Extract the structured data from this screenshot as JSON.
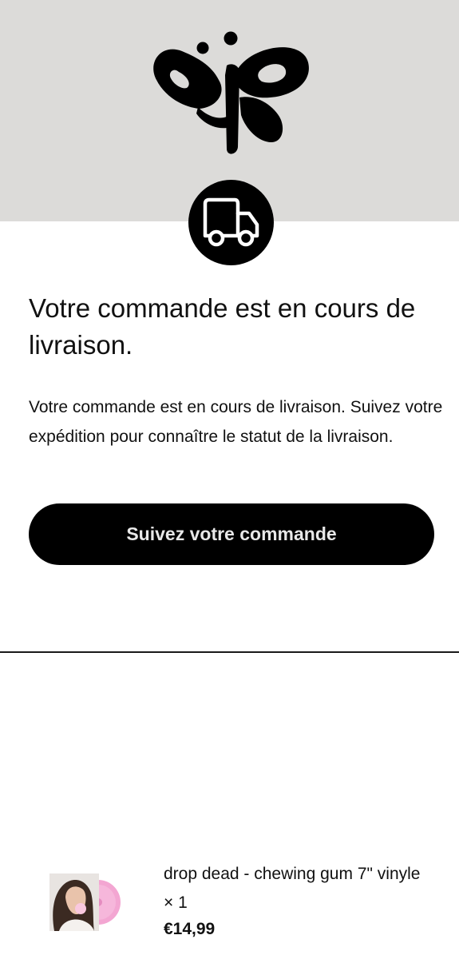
{
  "email": {
    "headline": "Votre commande est en cours de livraison.",
    "body": "Votre commande est en cours de livraison. Suivez votre expédition pour connaître le statut de la livraison.",
    "track_button_label": "Suivez votre commande"
  },
  "header": {
    "background_color": "#dcdbd9",
    "logo_icon": "butterfly-monogram-logo",
    "status_icon": "delivery-truck-icon"
  },
  "order_item": {
    "name": "drop dead - chewing gum 7\" vinyle × 1",
    "price": "€14,99",
    "thumbnail": "vinyl-cover-with-pink-record"
  },
  "colors": {
    "button_bg": "#000000",
    "button_text": "#e8e8e8",
    "text": "#111111"
  }
}
